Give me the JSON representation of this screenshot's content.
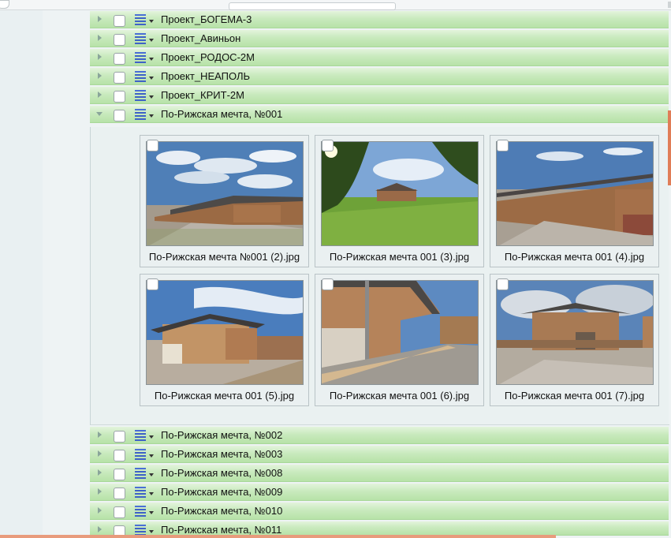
{
  "tree": {
    "rows_top": [
      {
        "label": "Проект_БОГЕМА-3"
      },
      {
        "label": "Проект_Авиньон"
      },
      {
        "label": "Проект_РОДОС-2М"
      },
      {
        "label": "Проект_НЕАПОЛЬ"
      },
      {
        "label": "Проект_КРИТ-2М"
      }
    ],
    "open_row": {
      "label": "По-Рижская мечта, №001"
    },
    "rows_bottom": [
      {
        "label": "По-Рижская мечта, №002"
      },
      {
        "label": "По-Рижская мечта, №003"
      },
      {
        "label": "По-Рижская мечта, №008"
      },
      {
        "label": "По-Рижская мечта, №009"
      },
      {
        "label": "По-Рижская мечта, №010"
      },
      {
        "label": "По-Рижская мечта, №011"
      }
    ]
  },
  "gallery": {
    "images": [
      {
        "caption": "По-Рижская мечта №001 (2).jpg"
      },
      {
        "caption": "По-Рижская мечта 001 (3).jpg"
      },
      {
        "caption": "По-Рижская мечта 001 (4).jpg"
      },
      {
        "caption": "По-Рижская мечта 001 (5).jpg"
      },
      {
        "caption": "По-Рижская мечта 001 (6).jpg"
      },
      {
        "caption": "По-Рижская мечта 001 (7).jpg"
      }
    ]
  },
  "colors": {
    "row_green": "#c9eabe",
    "menu_icon_blue": "#3e62c8",
    "accent_orange": "#e07d57"
  }
}
